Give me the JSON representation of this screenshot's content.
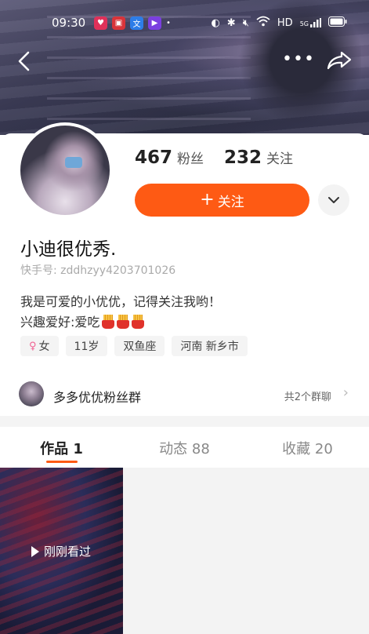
{
  "status_bar": {
    "time": "09:30",
    "network": "5G",
    "hd": "HD"
  },
  "profile": {
    "fans_count": "467",
    "fans_label": "粉丝",
    "following_count": "232",
    "following_label": "关注",
    "follow_button_label": "关注",
    "name": "小迪很优秀.",
    "kuaishou_id": "快手号: zddhzyy4203701026",
    "bio_line1": "我是可爱的小优优，记得关注我哟！",
    "bio_line2": "兴趣爱好:爱吃",
    "tags": [
      "女",
      "11岁",
      "双鱼座",
      "河南 新乡市"
    ]
  },
  "group": {
    "name": "多多优优粉丝群",
    "count_text": "共2个群聊"
  },
  "tabs": [
    {
      "label": "作品 1"
    },
    {
      "label": "动态 88"
    },
    {
      "label": "收藏 20"
    }
  ],
  "works": [
    {
      "badge": "刚刚看过"
    }
  ],
  "colors": {
    "accent": "#fe5a14"
  }
}
